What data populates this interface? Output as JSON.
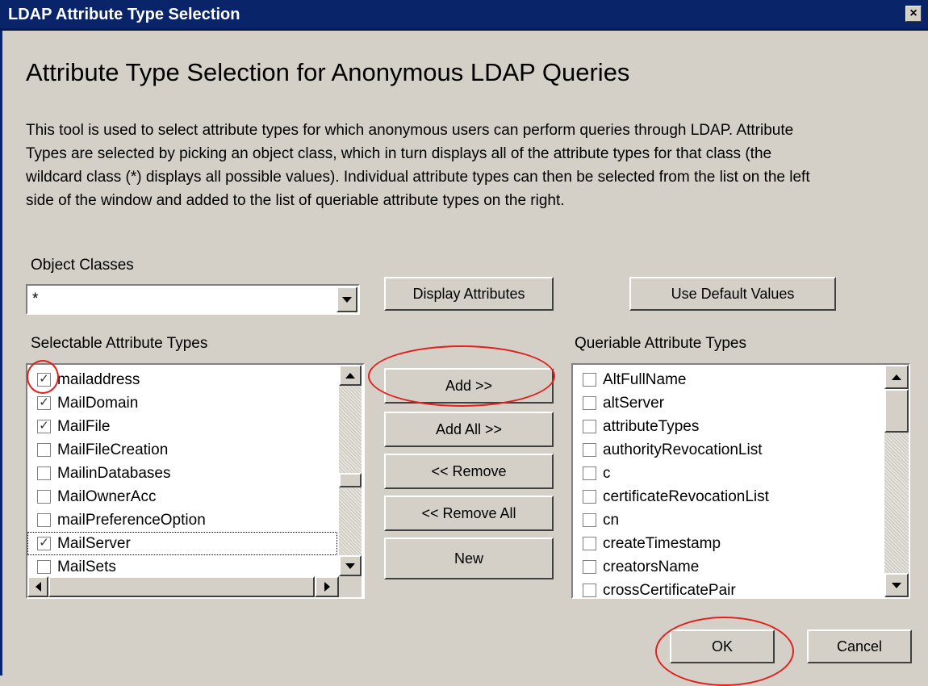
{
  "window": {
    "title": "LDAP Attribute Type Selection",
    "close_glyph": "×"
  },
  "heading": "Attribute Type Selection for Anonymous LDAP Queries",
  "description": "This tool is used to select attribute types for which anonymous users can perform queries through LDAP.  Attribute Types are selected by picking an object class, which in turn displays all of the attribute types for that class (the wildcard class (*) displays all possible values).  Individual attribute types can then be selected from the list on the left side of the window and added to the list of queriable attribute types on the right.",
  "object_classes": {
    "label": "Object Classes",
    "selected": "*"
  },
  "buttons": {
    "display_attributes": "Display Attributes",
    "use_default_values": "Use Default Values",
    "add": "Add >>",
    "add_all": "Add All >>",
    "remove": "<< Remove",
    "remove_all": "<< Remove All",
    "new": "New",
    "ok": "OK",
    "cancel": "Cancel"
  },
  "selectable": {
    "label": "Selectable Attribute Types",
    "items": [
      {
        "name": "mailaddress",
        "checked": true
      },
      {
        "name": "MailDomain",
        "checked": true
      },
      {
        "name": "MailFile",
        "checked": true
      },
      {
        "name": "MailFileCreation",
        "checked": false
      },
      {
        "name": "MailinDatabases",
        "checked": false
      },
      {
        "name": "MailOwnerAcc",
        "checked": false
      },
      {
        "name": "mailPreferenceOption",
        "checked": false
      },
      {
        "name": "MailServer",
        "checked": true
      },
      {
        "name": "MailSets",
        "checked": false
      }
    ]
  },
  "queriable": {
    "label": "Queriable Attribute Types",
    "items": [
      {
        "name": "AltFullName",
        "checked": false
      },
      {
        "name": "altServer",
        "checked": false
      },
      {
        "name": "attributeTypes",
        "checked": false
      },
      {
        "name": "authorityRevocationList",
        "checked": false
      },
      {
        "name": "c",
        "checked": false
      },
      {
        "name": "certificateRevocationList",
        "checked": false
      },
      {
        "name": "cn",
        "checked": false
      },
      {
        "name": "createTimestamp",
        "checked": false
      },
      {
        "name": "creatorsName",
        "checked": false
      },
      {
        "name": "crossCertificatePair",
        "checked": false
      }
    ]
  },
  "colors": {
    "titlebar": "#0a246a",
    "dialog": "#d4d0c8",
    "annotation": "#e0201c"
  }
}
